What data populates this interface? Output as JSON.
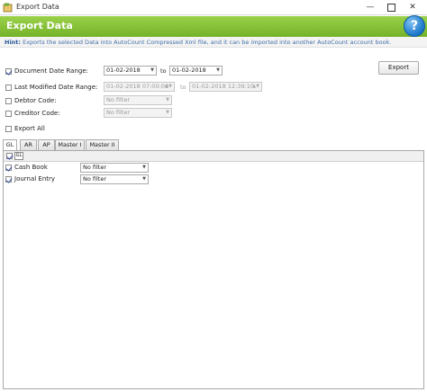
{
  "window": {
    "title": "Export Data"
  },
  "header": {
    "title": "Export Data",
    "help_symbol": "?"
  },
  "hint": {
    "label": "Hint:",
    "text": "Exports the selected Data into AutoCount Compressed Xml file, and it can be imported into another AutoCount account book."
  },
  "export_button": "Export",
  "filters": {
    "document_date": {
      "label": "Document Date Range:",
      "checked": true,
      "from": "01-02-2018",
      "to_label": "to",
      "to": "01-02-2018"
    },
    "last_modified": {
      "label": "Last Modified Date Range:",
      "checked": false,
      "from": "01-02-2018 07:00:00",
      "to_label": "to",
      "to": "01-02-2018 12:39:10"
    },
    "debtor_code": {
      "label": "Debtor Code:",
      "checked": false,
      "value": "No filter"
    },
    "creditor_code": {
      "label": "Creditor Code:",
      "checked": false,
      "value": "No filter"
    },
    "export_all": {
      "label": "Export All",
      "checked": false
    }
  },
  "tabs": [
    {
      "label": "GL",
      "active": true
    },
    {
      "label": "AR",
      "active": false
    },
    {
      "label": "AP",
      "active": false
    },
    {
      "label": "Master I",
      "active": false
    },
    {
      "label": "Master II",
      "active": false
    }
  ],
  "gl_panel": {
    "toolbar_label": "GL",
    "items": [
      {
        "label": "Cash Book",
        "checked": true,
        "value": "No filter"
      },
      {
        "label": "Journal Entry",
        "checked": true,
        "value": "No filter"
      }
    ]
  },
  "colors": {
    "header_green": "#8cc63f",
    "hint_blue": "#4470a8",
    "help_blue": "#1a76c9"
  }
}
